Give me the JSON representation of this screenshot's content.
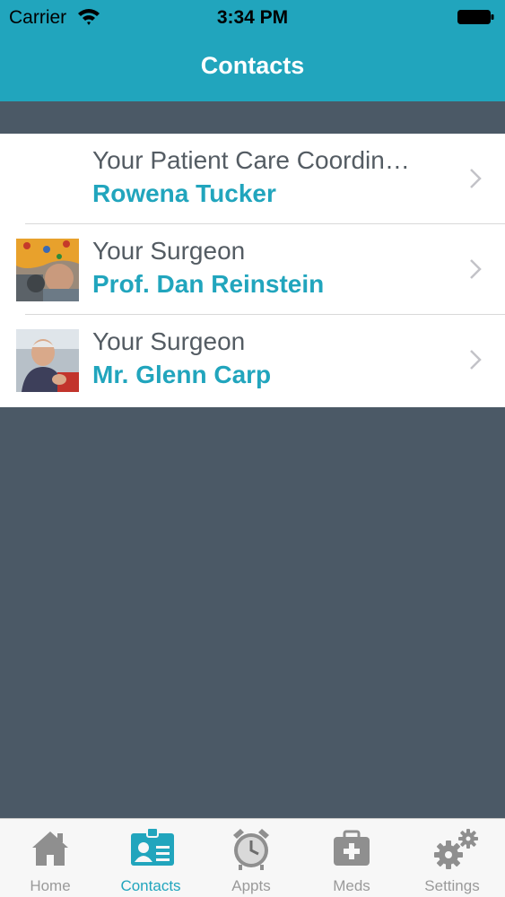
{
  "status_bar": {
    "carrier": "Carrier",
    "time": "3:34 PM",
    "wifi_icon": "wifi-icon",
    "battery_icon": "battery-icon"
  },
  "header": {
    "title": "Contacts",
    "background_color": "#21a5bd"
  },
  "contacts": [
    {
      "role": "Your Patient Care Coordin…",
      "name": "Rowena Tucker",
      "has_photo": false
    },
    {
      "role": "Your Surgeon",
      "name": "Prof. Dan Reinstein",
      "has_photo": true
    },
    {
      "role": "Your Surgeon",
      "name": "Mr. Glenn Carp",
      "has_photo": true
    }
  ],
  "tab_bar": {
    "tabs": [
      {
        "label": "Home",
        "icon": "home-icon",
        "active": false
      },
      {
        "label": "Contacts",
        "icon": "contact-card-icon",
        "active": true
      },
      {
        "label": "Appts",
        "icon": "alarm-clock-icon",
        "active": false
      },
      {
        "label": "Meds",
        "icon": "medical-kit-icon",
        "active": false
      },
      {
        "label": "Settings",
        "icon": "gears-icon",
        "active": false
      }
    ]
  },
  "colors": {
    "accent": "#21a5bd",
    "background": "#4b5966",
    "inactive_tab": "#9a9a9a"
  }
}
